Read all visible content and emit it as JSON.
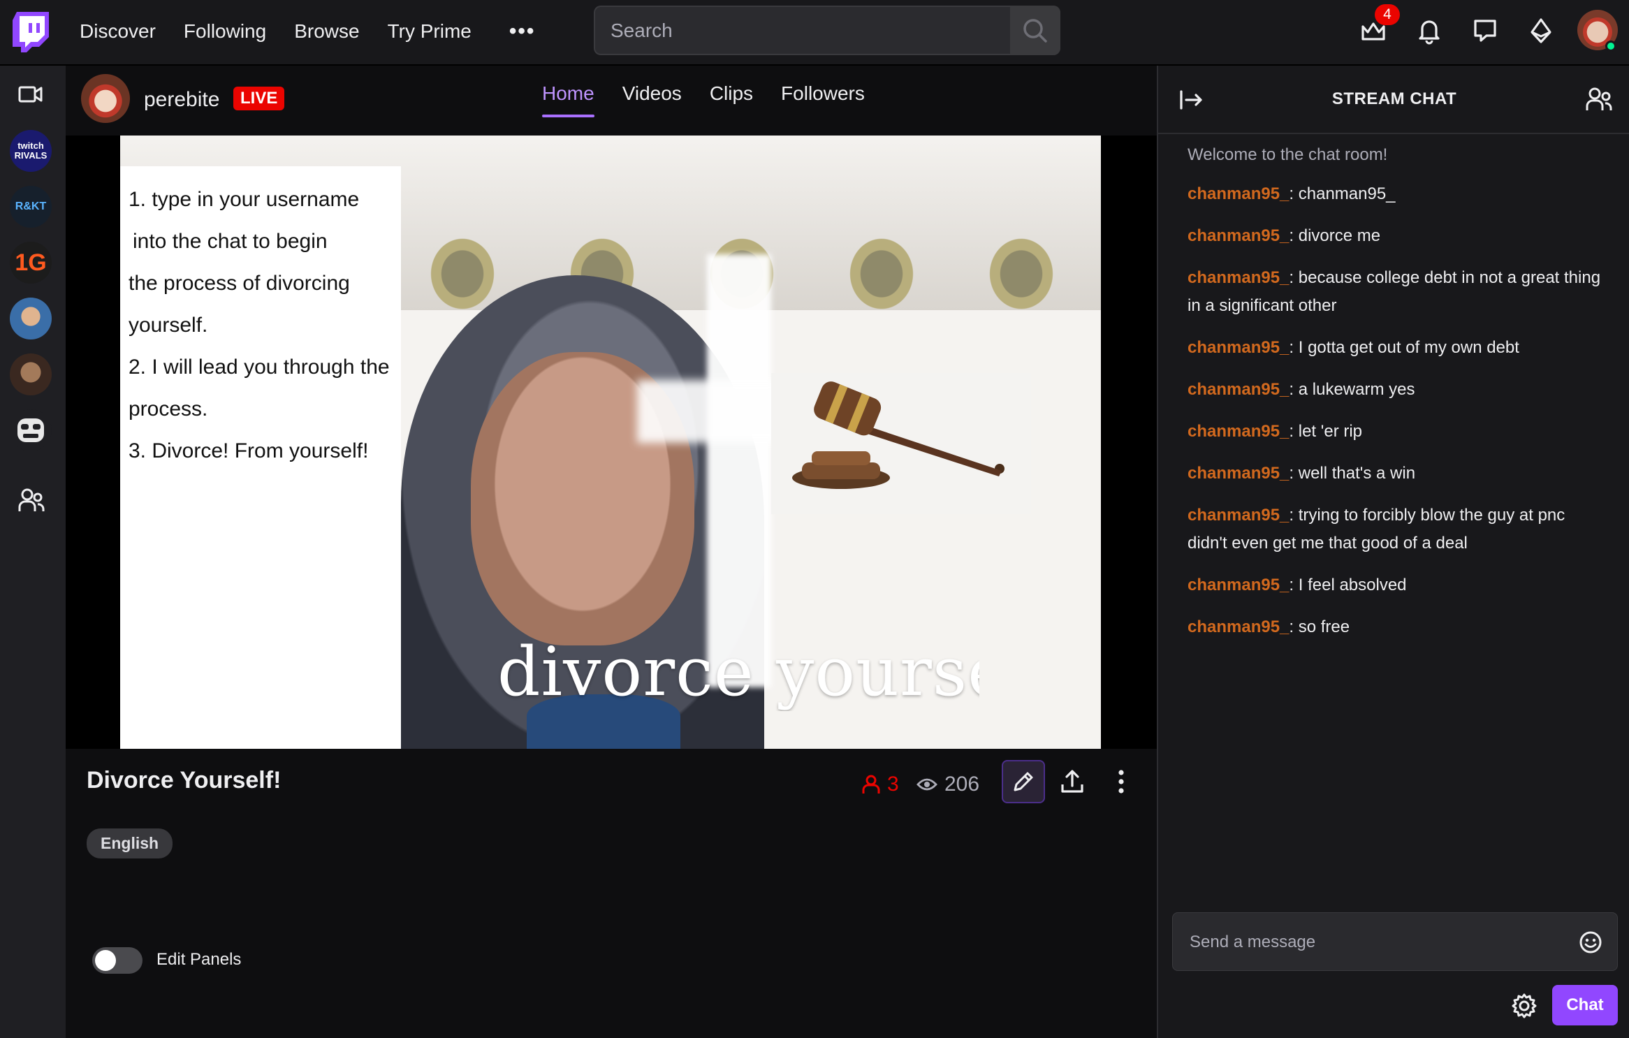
{
  "topnav": {
    "links": [
      "Discover",
      "Following",
      "Browse",
      "Try Prime"
    ],
    "more_label": "•••",
    "search_placeholder": "Search",
    "inbox_badge": "4"
  },
  "sidebar": {
    "items": [
      {
        "label": "twitch RIVALS",
        "color": "#2b2b8a"
      },
      {
        "label": "R&KT",
        "color": "#1b2a3a"
      },
      {
        "label": "1G",
        "color": "#1c1c1c"
      },
      {
        "label": "",
        "color": "#3a6ea8"
      },
      {
        "label": "",
        "color": "#4a3428"
      },
      {
        "label": "",
        "color": "#1f1f23"
      }
    ]
  },
  "channel": {
    "name": "perebite",
    "live_label": "LIVE",
    "tabs": [
      "Home",
      "Videos",
      "Clips",
      "Followers"
    ],
    "active_tab": "Home"
  },
  "video": {
    "instructions": [
      "1. type in your username",
      " into the chat to begin",
      "the process of divorcing",
      "yourself.",
      "2. I will lead you through the",
      "process.",
      "3. Divorce! From yourself!"
    ],
    "overlay_text": "divorce yourse"
  },
  "stream": {
    "title": "Divorce Yourself!",
    "viewers": "3",
    "views": "206",
    "language": "English",
    "edit_panels_label": "Edit Panels"
  },
  "chat": {
    "title": "STREAM CHAT",
    "welcome": "Welcome to the chat room!",
    "messages": [
      {
        "user": "chanman95_",
        "text": ": chanman95_"
      },
      {
        "user": "chanman95_",
        "text": ": divorce me"
      },
      {
        "user": "chanman95_",
        "text": ": because college debt in not a great thing in a significant other"
      },
      {
        "user": "chanman95_",
        "text": ": I gotta get out of my own debt"
      },
      {
        "user": "chanman95_",
        "text": ": a lukewarm yes"
      },
      {
        "user": "chanman95_",
        "text": ": let 'er rip"
      },
      {
        "user": "chanman95_",
        "text": ": well that's a win"
      },
      {
        "user": "chanman95_",
        "text": ": trying to forcibly blow the guy at pnc didn't even get me that good of a deal"
      },
      {
        "user": "chanman95_",
        "text": ": I feel absolved"
      },
      {
        "user": "chanman95_",
        "text": ": so free"
      }
    ],
    "input_placeholder": "Send a message",
    "send_label": "Chat",
    "username_color": "#d2691e"
  },
  "colors": {
    "accent": "#9147ff",
    "live": "#eb0400",
    "background": "#0e0e10"
  }
}
